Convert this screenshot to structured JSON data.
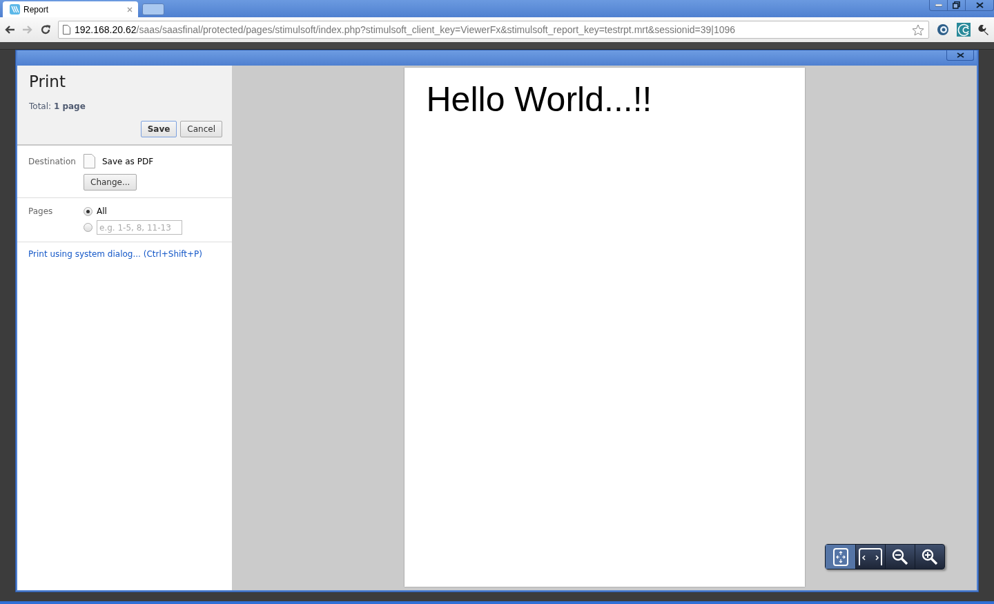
{
  "browser": {
    "tab": {
      "title": "Report"
    },
    "url_host": "192.168.20.62",
    "url_path": "/saas/saasfinal/protected/pages/stimulsoft/index.php?stimulsoft_client_key=ViewerFx&stimulsoft_report_key=testrpt.mrt&sessionid=39|1096"
  },
  "print_dialog": {
    "title": "Print",
    "total_label": "Total:",
    "total_value": "1 page",
    "buttons": [
      {
        "label": "Save",
        "kind": "primary"
      },
      {
        "label": "Cancel",
        "kind": "default"
      }
    ],
    "destination": {
      "label": "Destination",
      "value": "Save as PDF",
      "change_button": "Change..."
    },
    "pages": {
      "label": "Pages",
      "options": [
        {
          "kind": "all",
          "label": "All",
          "selected": true
        },
        {
          "kind": "range",
          "placeholder": "e.g. 1-5, 8, 11-13",
          "selected": false
        }
      ]
    },
    "system_dialog_link": "Print using system dialog... (Ctrl+Shift+P)"
  },
  "preview": {
    "page_text": "Hello World...!!",
    "zoom_tools": [
      {
        "kind": "fit",
        "selected": true
      },
      {
        "kind": "width",
        "selected": false
      },
      {
        "kind": "zoom-out",
        "selected": false
      },
      {
        "kind": "zoom-in",
        "selected": false
      }
    ]
  }
}
